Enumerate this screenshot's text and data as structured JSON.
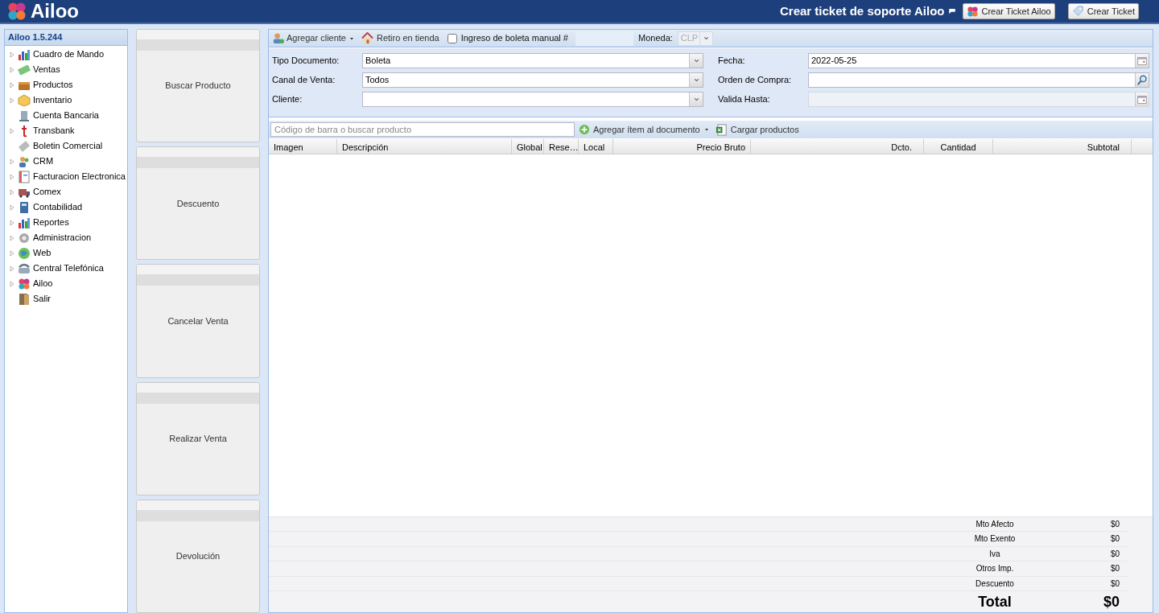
{
  "header": {
    "logo": "Ailoo",
    "support_title": "Crear ticket de soporte Ailoo",
    "buttons": [
      {
        "label": "Crear Ticket Ailoo",
        "kind": "flower"
      },
      {
        "label": "Crear Ticket",
        "kind": "tag"
      }
    ]
  },
  "sidebar": {
    "title": "Ailoo 1.5.244",
    "items": [
      {
        "label": "Cuadro de Mando",
        "has_children": true
      },
      {
        "label": "Ventas",
        "has_children": true
      },
      {
        "label": "Productos",
        "has_children": true
      },
      {
        "label": "Inventario",
        "has_children": true
      },
      {
        "label": "Cuenta Bancaria",
        "has_children": false
      },
      {
        "label": "Transbank",
        "has_children": true
      },
      {
        "label": "Boletin Comercial",
        "has_children": false
      },
      {
        "label": "CRM",
        "has_children": true
      },
      {
        "label": "Facturacion Electronica",
        "has_children": true
      },
      {
        "label": "Comex",
        "has_children": true
      },
      {
        "label": "Contabilidad",
        "has_children": true
      },
      {
        "label": "Reportes",
        "has_children": true
      },
      {
        "label": "Administracion",
        "has_children": true
      },
      {
        "label": "Web",
        "has_children": true
      },
      {
        "label": "Central Telefónica",
        "has_children": true
      },
      {
        "label": "Ailoo",
        "has_children": true
      },
      {
        "label": "Salir",
        "has_children": false
      }
    ]
  },
  "actions": [
    "Buscar Producto",
    "Descuento",
    "Cancelar Venta",
    "Realizar Venta",
    "Devolución"
  ],
  "toolbar": {
    "add_client": "Agregar cliente",
    "pickup": "Retiro en tienda",
    "manual_receipt": {
      "label": "Ingreso de boleta manual #",
      "checked": false
    },
    "currency": {
      "label": "Moneda:",
      "value": "CLP",
      "disabled": true
    }
  },
  "form": {
    "left": [
      {
        "label": "Tipo Documento:",
        "value": "Boleta"
      },
      {
        "label": "Canal de Venta:",
        "value": "Todos"
      },
      {
        "label": "Cliente:"
      }
    ],
    "right": [
      {
        "label": "Fecha:",
        "value": "2022-05-25",
        "kind": "date",
        "disabled": false
      },
      {
        "label": "Orden de Compra:",
        "kind": "search",
        "disabled": false
      },
      {
        "label": "Valida Hasta:",
        "kind": "date",
        "disabled": true
      }
    ]
  },
  "product_bar": {
    "search_placeholder": "Código de barra o buscar producto",
    "add_item": "Agregar ítem al documento",
    "load": "Cargar productos"
  },
  "table": {
    "columns": [
      "Imagen",
      "Descripción",
      "Global",
      "Rese…",
      "Local",
      "Precio Bruto",
      "Dcto.",
      "Cantidad",
      "Subtotal"
    ]
  },
  "totals": [
    {
      "label": "Mto Afecto",
      "value": "$0"
    },
    {
      "label": "Mto Exento",
      "value": "$0"
    },
    {
      "label": "Iva",
      "value": "$0"
    },
    {
      "label": "Otros Imp.",
      "value": "$0"
    },
    {
      "label": "Descuento",
      "value": "$0"
    }
  ],
  "total": {
    "label": "Total",
    "value": "$0"
  }
}
